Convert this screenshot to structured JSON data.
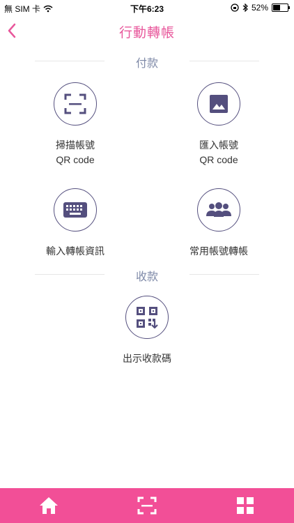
{
  "status_bar": {
    "carrier": "無 SIM 卡",
    "time": "下午6:23",
    "battery_percent": "52%",
    "battery_level": 0.52
  },
  "nav": {
    "title": "行動轉帳",
    "back_icon": "chevron-left-icon"
  },
  "sections": {
    "pay": {
      "title": "付款"
    },
    "receive": {
      "title": "收款"
    }
  },
  "actions": {
    "scan_qr": {
      "line1": "掃描帳號",
      "line2": "QR code",
      "icon": "scan-frame-icon"
    },
    "import_qr": {
      "line1": "匯入帳號",
      "line2": "QR code",
      "icon": "image-icon"
    },
    "input_info": {
      "line1": "輸入轉帳資訊",
      "icon": "keyboard-icon"
    },
    "common_accounts": {
      "line1": "常用帳號轉帳",
      "icon": "group-icon"
    },
    "show_qr": {
      "line1": "出示收款碼",
      "icon": "qr-code-icon"
    }
  },
  "tabbar": {
    "items": [
      "home-icon",
      "scan-frame-icon",
      "grid-menu-icon"
    ]
  },
  "colors": {
    "accent": "#e8579b",
    "tabbar": "#f24f97",
    "icon": "#544f7e",
    "section_label": "#7f8aa8"
  }
}
